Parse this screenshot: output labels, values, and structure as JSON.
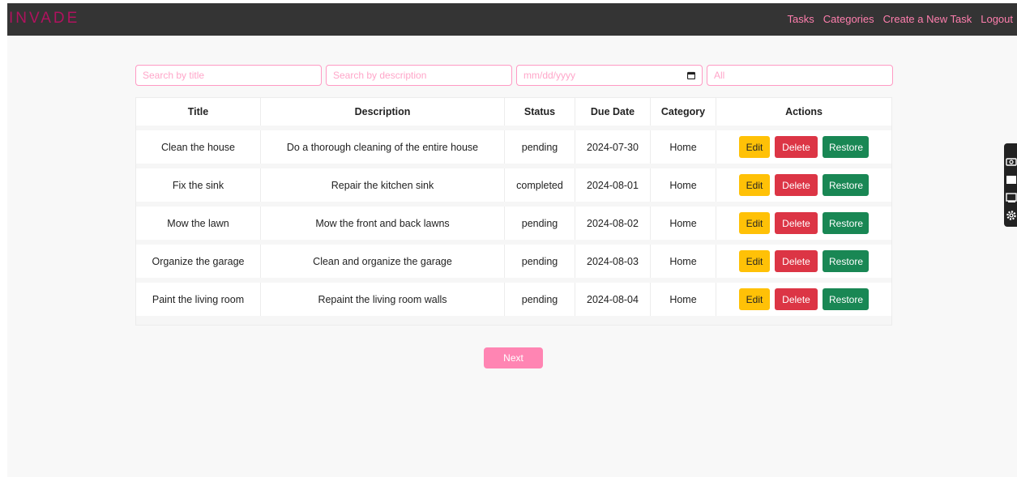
{
  "app": {
    "brand": "INVADE"
  },
  "nav": {
    "links": [
      "Tasks",
      "Categories",
      "Create a New Task",
      "Logout"
    ]
  },
  "filters": {
    "title_placeholder": "Search by title",
    "description_placeholder": "Search by description",
    "date_placeholder": "mm/dd/yyyy",
    "category_value": "All"
  },
  "table": {
    "headers": [
      "Title",
      "Description",
      "Status",
      "Due Date",
      "Category",
      "Actions"
    ],
    "rows": [
      {
        "title": "Clean the house",
        "description": "Do a thorough cleaning of the entire house",
        "status": "pending",
        "due": "2024-07-30",
        "category": "Home"
      },
      {
        "title": "Fix the sink",
        "description": "Repair the kitchen sink",
        "status": "completed",
        "due": "2024-08-01",
        "category": "Home"
      },
      {
        "title": "Mow the lawn",
        "description": "Mow the front and back lawns",
        "status": "pending",
        "due": "2024-08-02",
        "category": "Home"
      },
      {
        "title": "Organize the garage",
        "description": "Clean and organize the garage",
        "status": "pending",
        "due": "2024-08-03",
        "category": "Home"
      },
      {
        "title": "Paint the living room",
        "description": "Repaint the living room walls",
        "status": "pending",
        "due": "2024-08-04",
        "category": "Home"
      }
    ],
    "actions": {
      "edit": "Edit",
      "delete": "Delete",
      "restore": "Restore"
    }
  },
  "pagination": {
    "next_label": "Next"
  },
  "colors": {
    "brand": "#b0125e",
    "accent": "#ff85b3",
    "edit": "#ffc107",
    "delete": "#dc3545",
    "restore": "#198754",
    "navbar": "#343434"
  },
  "side_toolbar": {
    "icons": [
      "camera-icon",
      "screen-icon",
      "window-icon",
      "gear-icon"
    ]
  }
}
